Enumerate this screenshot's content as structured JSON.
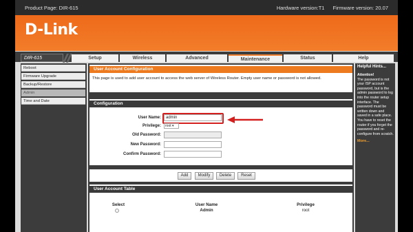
{
  "header": {
    "product": "Product Page: DIR-615",
    "hardware": "Hardware version:T1",
    "firmware": "Firmware version: 20.07"
  },
  "brand": {
    "logo": "D-Link",
    "model": "DIR-615"
  },
  "tabs": [
    {
      "label": "Setup"
    },
    {
      "label": "Wireless"
    },
    {
      "label": "Advanced"
    },
    {
      "label": "Maintenance"
    },
    {
      "label": "Status"
    },
    {
      "label": "Help"
    }
  ],
  "sidebar": {
    "items": [
      {
        "label": "Reboot"
      },
      {
        "label": "Firmware Upgrade"
      },
      {
        "label": "Backup/Restore"
      },
      {
        "label": "Admin"
      },
      {
        "label": "Time and Date"
      }
    ]
  },
  "user_account": {
    "title": "User Account Configuration",
    "description": "This page is used to add user account to access the web server of Wireless Router. Empty user name or password is not allowed."
  },
  "configuration": {
    "title": "Configuration",
    "username_label": "User Name:",
    "username_value": "admin",
    "privilege_label": "Privilege:",
    "privilege_value": "root",
    "old_password_label": "Old Password:",
    "new_password_label": "New Password:",
    "confirm_password_label": "Confirm Password:"
  },
  "buttons": {
    "add": "Add",
    "modify": "Modify",
    "delete": "Delete",
    "reset": "Reset"
  },
  "table": {
    "title": "User Account Table",
    "headers": [
      "Select",
      "User Name",
      "Privilege"
    ],
    "rows": [
      {
        "user": "Admin",
        "privilege": "root"
      }
    ]
  },
  "help": {
    "title": "Helpful Hints...",
    "attention": "Attention!",
    "text": "The password is not your ISP account password, but is the admin password to log into the router setup interface. The password must be written down and saved in a safe place. You have to reset the router if you forget the password and re-configure from scratch.",
    "more": "More..."
  },
  "colors": {
    "accent": "#ee7a20",
    "highlight": "#d41f1f",
    "dark": "#3c3c3c"
  }
}
